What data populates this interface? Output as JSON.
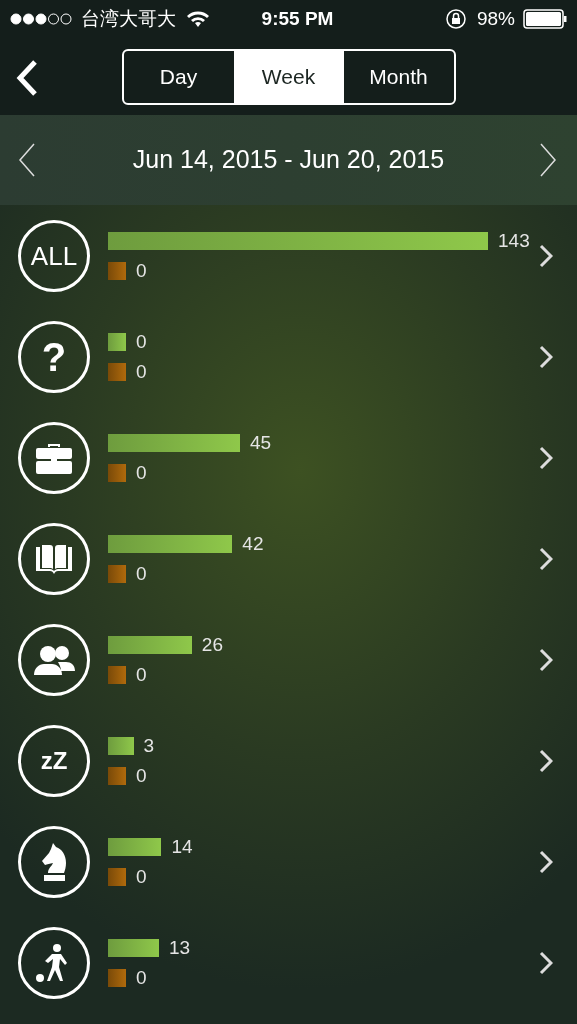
{
  "status_bar": {
    "carrier": "台湾大哥大",
    "time": "9:55 PM",
    "battery": "98%"
  },
  "segments": [
    {
      "label": "Day",
      "selected": false
    },
    {
      "label": "Week",
      "selected": true
    },
    {
      "label": "Month",
      "selected": false
    }
  ],
  "date_range": "Jun 14, 2015 - Jun 20, 2015",
  "categories": [
    {
      "kind": "all",
      "icon_label": "ALL",
      "primary": "143",
      "secondary": "0"
    },
    {
      "kind": "unknown",
      "icon_label": "?",
      "primary": "0",
      "secondary": "0"
    },
    {
      "kind": "work",
      "primary": "45",
      "secondary": "0"
    },
    {
      "kind": "study",
      "primary": "42",
      "secondary": "0"
    },
    {
      "kind": "social",
      "primary": "26",
      "secondary": "0"
    },
    {
      "kind": "sleep",
      "icon_label": "zZ",
      "primary": "3",
      "secondary": "0"
    },
    {
      "kind": "games",
      "primary": "14",
      "secondary": "0"
    },
    {
      "kind": "sports",
      "primary": "13",
      "secondary": "0"
    }
  ]
}
